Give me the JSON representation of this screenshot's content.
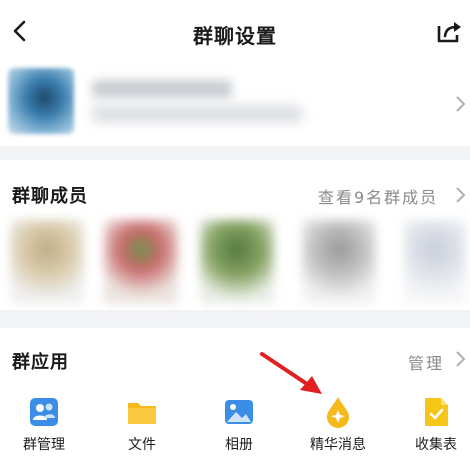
{
  "header": {
    "title": "群聊设置"
  },
  "members": {
    "title": "群聊成员",
    "action": "查看9名群成员"
  },
  "apps": {
    "title": "群应用",
    "action": "管理",
    "items": [
      {
        "label": "群管理",
        "icon": "group-manage-icon",
        "color": "#3a8ee6"
      },
      {
        "label": "文件",
        "icon": "folder-icon",
        "color": "#f5b91a"
      },
      {
        "label": "相册",
        "icon": "photo-album-icon",
        "color": "#3a8ee6"
      },
      {
        "label": "精华消息",
        "icon": "essence-drop-icon",
        "color": "#f5b91a"
      },
      {
        "label": "收集表",
        "icon": "collect-form-icon",
        "color": "#f5c518"
      }
    ]
  },
  "colors": {
    "accent_blue": "#3a8ee6",
    "accent_yellow": "#f5b91a",
    "arrow_red": "#e02020"
  }
}
